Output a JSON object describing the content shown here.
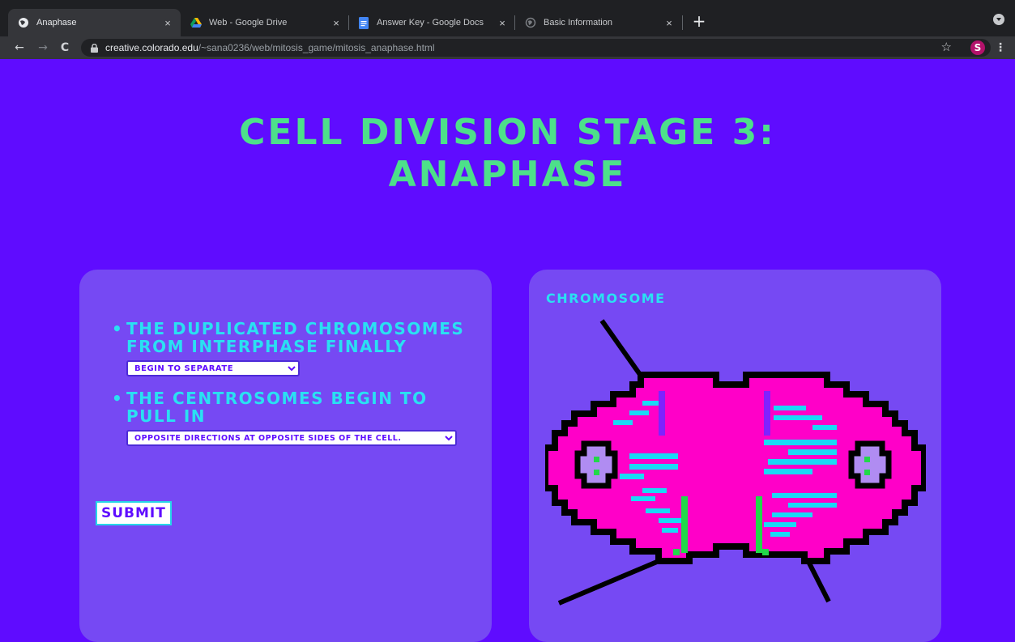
{
  "browser": {
    "tabs": [
      {
        "title": "Anaphase",
        "favicon": "globe-icon",
        "active": true
      },
      {
        "title": "Web - Google Drive",
        "favicon": "google-drive-icon",
        "active": false
      },
      {
        "title": "Answer Key - Google Docs",
        "favicon": "google-docs-icon",
        "active": false
      },
      {
        "title": "Basic Information",
        "favicon": "globe-icon",
        "active": false
      }
    ],
    "close_glyph": "×",
    "new_tab_glyph": "+",
    "url_host": "creative.colorado.edu",
    "url_path": "/~sana0236/web/mitosis_game/mitosis_anaphase.html",
    "back_glyph": "←",
    "forward_glyph": "→",
    "reload_glyph": "C",
    "star_glyph": "☆",
    "avatar_letter": "S",
    "menu_glyph": "⋮"
  },
  "page": {
    "title_line1": "Cell Division Stage 3:",
    "title_line2": "Anaphase",
    "questions": [
      {
        "prompt": "The duplicated chromosomes from interphase finally",
        "selected": "Begin to separate"
      },
      {
        "prompt": "The centrosomes begin to pull in",
        "selected": "Opposite directions at opposite sides of the cell."
      }
    ],
    "submit_label": "Submit",
    "image_label": "Chromosome"
  },
  "colors": {
    "background": "#5f0cff",
    "panel": "#7649f3",
    "title": "#4de08a",
    "question_text": "#2ae0f2",
    "cell_body": "#ff00c8",
    "cell_outline": "#000000",
    "chromosome_cyan": "#1ad9f5",
    "centromere_green": "#22d84a",
    "centrosome_lilac": "#b08cf2"
  }
}
